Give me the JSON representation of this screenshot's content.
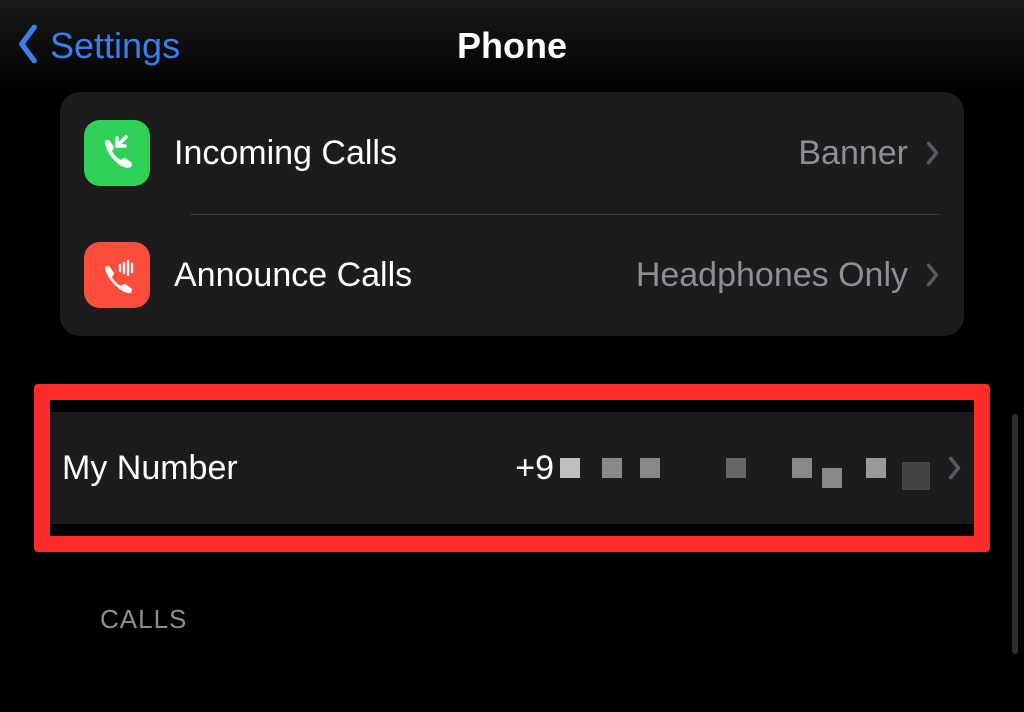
{
  "header": {
    "back_label": "Settings",
    "title": "Phone"
  },
  "icons": {
    "incoming": "phone-incoming-icon",
    "announce": "phone-announce-icon"
  },
  "rows": {
    "incoming": {
      "label": "Incoming Calls",
      "value": "Banner"
    },
    "announce": {
      "label": "Announce Calls",
      "value": "Headphones Only"
    }
  },
  "my_number": {
    "label": "My Number",
    "value_prefix": "+9"
  },
  "section_headers": {
    "calls": "CALLS"
  }
}
